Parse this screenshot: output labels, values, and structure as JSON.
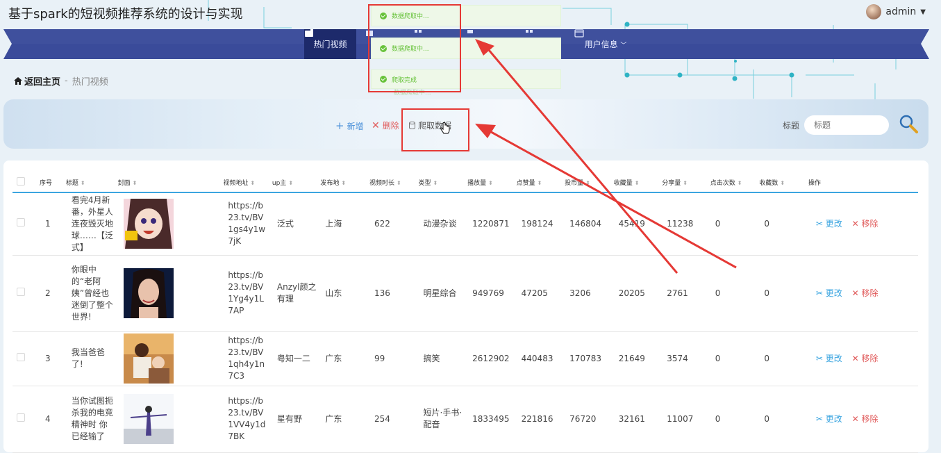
{
  "app": {
    "title": "基于spark的短视频推荐系统的设计与实现"
  },
  "user": {
    "name": "admin"
  },
  "nav": {
    "active_label": "热门视频",
    "user_info_label": "用户信息"
  },
  "breadcrumb": {
    "home": "返回主页",
    "separator": "-",
    "current": "热门视频"
  },
  "toolbar": {
    "add": "新增",
    "delete": "删除",
    "crawl": "爬取数据"
  },
  "search": {
    "label": "标题",
    "placeholder": "标题"
  },
  "notifications": [
    "数据爬取中...",
    "数据爬取中...",
    "爬取完成"
  ],
  "notification_ghost": "数据爬取中...",
  "table": {
    "headers": [
      "序号",
      "标题",
      "封面",
      "视频地址",
      "up主",
      "发布地",
      "视频时长",
      "类型",
      "播放量",
      "点赞量",
      "投币量",
      "收藏量",
      "分享量",
      "点击次数",
      "收藏数",
      "操作"
    ],
    "edit_label": "更改",
    "remove_label": "移除",
    "rows": [
      {
        "idx": "1",
        "title": "看完4月新番，外星人连夜毁灭地球……【泛式】",
        "url": "https://b23.tv/BV1gs4y1w7jK",
        "up": "泛式",
        "place": "上海",
        "duration": "622",
        "type": "动漫杂谈",
        "play": "1220871",
        "like": "198124",
        "coin": "146804",
        "fav": "45419",
        "share": "11238",
        "clicks": "0",
        "favs": "0"
      },
      {
        "idx": "2",
        "title": "你眼中的“老阿姨”曾经也迷倒了整个世界!",
        "url": "https://b23.tv/BV1Yg4y1L7AP",
        "up": "Anzyl颜之有理",
        "place": "山东",
        "duration": "136",
        "type": "明星综合",
        "play": "949769",
        "like": "47205",
        "coin": "3206",
        "fav": "20205",
        "share": "2761",
        "clicks": "0",
        "favs": "0"
      },
      {
        "idx": "3",
        "title": "我当爸爸了!",
        "url": "https://b23.tv/BV1qh4y1n7C3",
        "up": "粤知一二",
        "place": "广东",
        "duration": "99",
        "type": "搞笑",
        "play": "2612902",
        "like": "440483",
        "coin": "170783",
        "fav": "21649",
        "share": "3574",
        "clicks": "0",
        "favs": "0"
      },
      {
        "idx": "4",
        "title": "当你试图扼杀我的电竞精神时 你已经输了",
        "url": "https://b23.tv/BV1VV4y1d7BK",
        "up": "星有野",
        "place": "广东",
        "duration": "254",
        "type": "短片·手书·配音",
        "play": "1833495",
        "like": "221816",
        "coin": "76720",
        "fav": "32161",
        "share": "11007",
        "clicks": "0",
        "favs": "0"
      }
    ]
  },
  "colors": {
    "nav_bg": "#3a4b9a",
    "nav_active": "#1d2a6b",
    "accent": "#3ba5e0",
    "danger": "#e05a5a",
    "success": "#67c23a",
    "annotation_red": "#e53935"
  },
  "icons": [
    "home-icon",
    "plus-icon",
    "close-icon",
    "database-icon",
    "search-icon",
    "edit-icon",
    "check-circle-icon",
    "video-icon",
    "user-card-icon",
    "chevron-down-icon"
  ]
}
